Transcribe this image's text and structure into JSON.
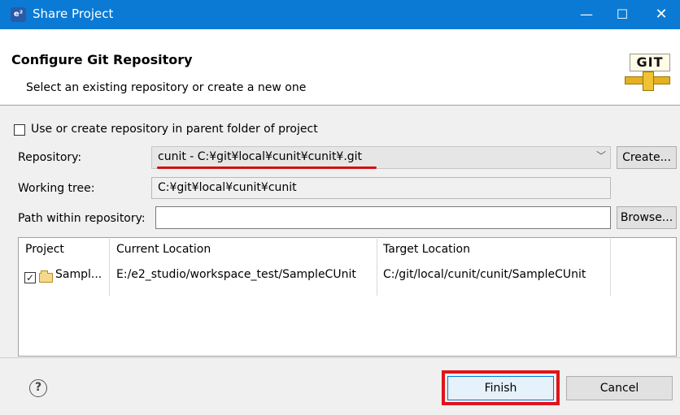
{
  "window": {
    "icon_text": "e²",
    "title": "Share Project",
    "minimize": "—",
    "maximize": "☐",
    "close": "✕"
  },
  "header": {
    "title": "Configure Git Repository",
    "subtitle": "Select an existing repository or create a new one",
    "logo_text": "GIT"
  },
  "parent_folder": {
    "label": "Use or create repository in parent folder of project",
    "checked": false
  },
  "repository": {
    "label": "Repository:",
    "value": "cunit - C:¥git¥local¥cunit¥cunit¥.git",
    "create_label": "Create..."
  },
  "working_tree": {
    "label": "Working tree:",
    "value": "C:¥git¥local¥cunit¥cunit"
  },
  "path_within": {
    "label": "Path within repository:",
    "value": "",
    "browse_label": "Browse..."
  },
  "table": {
    "headers": [
      "Project",
      "Current Location",
      "Target Location"
    ],
    "rows": [
      {
        "checked": "✓",
        "project": "Sampl...",
        "current": "E:/e2_studio/workspace_test/SampleCUnit",
        "target": "C:/git/local/cunit/cunit/SampleCUnit"
      }
    ]
  },
  "footer": {
    "help": "?",
    "finish_label": "Finish",
    "cancel_label": "Cancel"
  },
  "colors": {
    "titlebar": "#0b7ad4",
    "highlight": "#e0141a"
  }
}
